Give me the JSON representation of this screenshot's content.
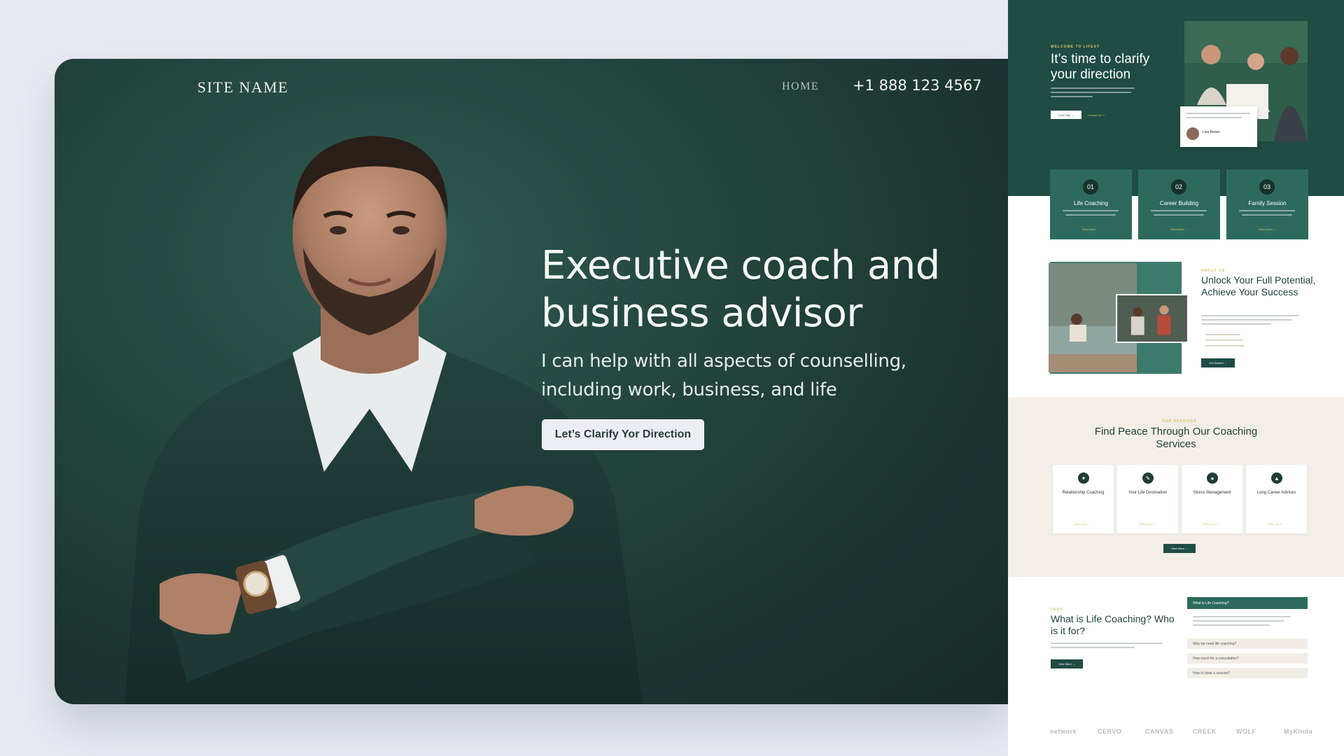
{
  "hero": {
    "site_name": "SITE NAME",
    "nav_home": "HOME",
    "phone": "+1 888 123 4567",
    "title": "Executive coach and business advisor",
    "subtitle": "I can help with all aspects of counselling, including work, business, and life",
    "cta": "Let’s Clarify Yor Direction"
  },
  "preview": {
    "kicker": "WELCOME TO LIFEXY",
    "heading": "It’s time to clarify your direction",
    "btn_primary": "Let’s Talk →",
    "btn_link": "Contact Us ↗",
    "quote_name": "Lisa Brown",
    "cards": [
      {
        "num": "01",
        "title": "Life Coaching",
        "more": "Read More →"
      },
      {
        "num": "02",
        "title": "Career Building",
        "more": "Read More →"
      },
      {
        "num": "03",
        "title": "Family Session",
        "more": "Read More →"
      }
    ],
    "about_kicker": "ABOUT US",
    "about_heading": "Unlock Your Full Potential, Achieve Your Success",
    "about_btn": "Get Started →",
    "services_kicker": "OUR SERVICES",
    "services_heading": "Find Peace Through Our Coaching Services",
    "services": [
      {
        "title": "Relationship Coaching",
        "more": "Read More →"
      },
      {
        "title": "Your Life Destination",
        "more": "Read More →"
      },
      {
        "title": "Stress Management",
        "more": "Read More →"
      },
      {
        "title": "Long Career Advices",
        "more": "Read More →"
      }
    ],
    "services_btn": "View More →",
    "faq_kicker": "FAQS",
    "faq_heading": "What is Life Coaching? Who is it for?",
    "faq_btn": "View More →",
    "faq_items": [
      "What is Life Coaching?",
      "Why we need life coaching?",
      "How much for a consultation?",
      "How to book a session?"
    ],
    "logos": [
      "network",
      "CERVO",
      "CANVAS",
      "CREEK",
      "WOLF",
      "MyKinda"
    ]
  },
  "colors": {
    "hero_bg": "#1f3f39",
    "brand_green": "#1f4c43",
    "card_green": "#2d6a5d",
    "accent_gold": "#d8c36a",
    "services_bg": "#f3eee7"
  }
}
